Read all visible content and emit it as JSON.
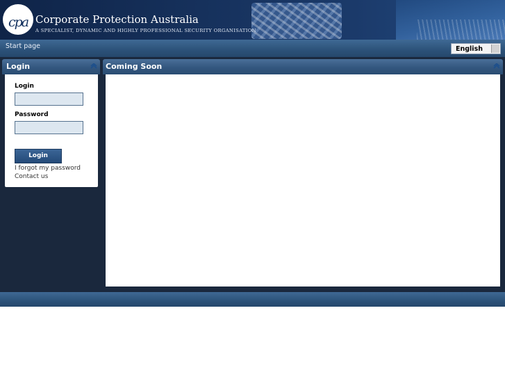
{
  "header": {
    "logo_text": "cpa",
    "title": "Corporate Protection Australia",
    "tagline": "A SPECIALIST, DYNAMIC AND HIGHLY PROFESSIONAL SECURITY ORGANISATION"
  },
  "nav": {
    "start_page": "Start page",
    "language": {
      "selected": "English"
    }
  },
  "login_panel": {
    "title": "Login",
    "login_label": "Login",
    "login_value": "",
    "password_label": "Password",
    "password_value": "",
    "submit_label": "Login",
    "forgot_link": "I forgot my password",
    "contact_link": "Contact us"
  },
  "content_panel": {
    "title": "Coming Soon"
  },
  "colors": {
    "background": "#1a283d",
    "header_bar": "#2c5279",
    "accent": "#244a78",
    "input_fill": "#dde7f0"
  }
}
